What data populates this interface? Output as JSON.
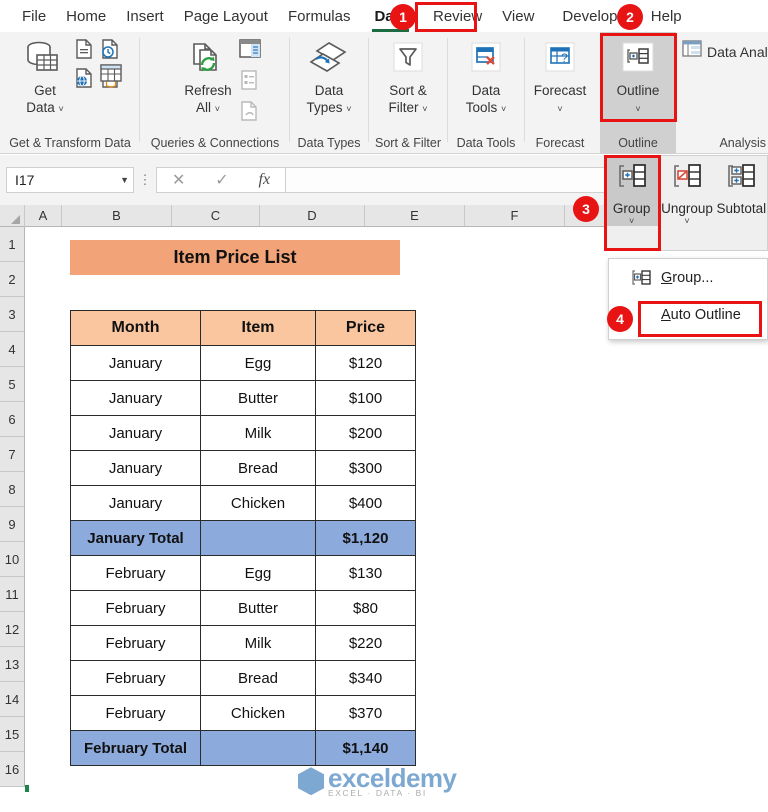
{
  "app": {
    "tabs": [
      {
        "label": "File",
        "active": false
      },
      {
        "label": "Home",
        "active": false
      },
      {
        "label": "Insert",
        "active": false
      },
      {
        "label": "Page Layout",
        "active": false
      },
      {
        "label": "Formulas",
        "active": false
      },
      {
        "label": "Data",
        "active": true
      },
      {
        "label": "Review",
        "active": false
      },
      {
        "label": "View",
        "active": false
      },
      {
        "label": "Developer",
        "active": false
      },
      {
        "label": "Help",
        "active": false
      }
    ]
  },
  "ribbon": {
    "groups": [
      {
        "name": "Get & Transform Data",
        "buttons": [
          {
            "caption_line1": "Get",
            "caption_line2": "Data",
            "has_chevron": true
          }
        ]
      },
      {
        "name": "Queries & Connections",
        "buttons": [
          {
            "caption_line1": "Refresh",
            "caption_line2": "All",
            "has_chevron": true
          }
        ]
      },
      {
        "name": "Data Types",
        "buttons": [
          {
            "caption_line1": "Data",
            "caption_line2": "Types",
            "has_chevron": true
          }
        ]
      },
      {
        "name": "Sort & Filter",
        "buttons": [
          {
            "caption_line1": "Sort &",
            "caption_line2": "Filter",
            "has_chevron": true
          }
        ]
      },
      {
        "name": "Data Tools",
        "buttons": [
          {
            "caption_line1": "Data",
            "caption_line2": "Tools",
            "has_chevron": true
          }
        ]
      },
      {
        "name": "Forecast",
        "buttons": [
          {
            "caption_line1": "Forecast",
            "caption_line2": "",
            "has_chevron": true
          }
        ]
      },
      {
        "name": "Outline",
        "buttons": [
          {
            "caption_line1": "Outline",
            "caption_line2": "",
            "has_chevron": true
          }
        ]
      },
      {
        "name": "Analysis",
        "buttons": [
          {
            "caption_line1": "Data Analysis",
            "caption_line2": "",
            "has_chevron": false
          }
        ]
      }
    ],
    "outline_flyout": {
      "buttons": [
        {
          "label": "Group",
          "selected": true,
          "has_chevron": true
        },
        {
          "label": "Ungroup",
          "selected": false,
          "has_chevron": true
        },
        {
          "label": "Subtotal",
          "selected": false,
          "has_chevron": false
        }
      ]
    },
    "group_menu": {
      "items": [
        {
          "label": "Group...",
          "underline_char": "G",
          "has_icon": true,
          "highlighted": false
        },
        {
          "label": "Auto Outline",
          "underline_char": "A",
          "has_icon": false,
          "highlighted": true
        }
      ]
    }
  },
  "formula_bar": {
    "name_box_value": "I17",
    "cancel_icon": "cancel-icon",
    "confirm_icon": "confirm-icon",
    "function_icon": "fx-icon",
    "formula_value": ""
  },
  "grid": {
    "columns": [
      "A",
      "B",
      "C",
      "D",
      "E",
      "F"
    ],
    "rows": [
      "1",
      "2",
      "3",
      "4",
      "5",
      "6",
      "7",
      "8",
      "9",
      "10",
      "11",
      "12",
      "13",
      "14",
      "15",
      "16"
    ]
  },
  "worksheet": {
    "title": "Item Price List",
    "headers": [
      "Month",
      "Item",
      "Price"
    ],
    "rows": [
      {
        "month": "January",
        "item": "Egg",
        "price": "$120",
        "total": false
      },
      {
        "month": "January",
        "item": "Butter",
        "price": "$100",
        "total": false
      },
      {
        "month": "January",
        "item": "Milk",
        "price": "$200",
        "total": false
      },
      {
        "month": "January",
        "item": "Bread",
        "price": "$300",
        "total": false
      },
      {
        "month": "January",
        "item": "Chicken",
        "price": "$400",
        "total": false
      },
      {
        "month": "January Total",
        "item": "",
        "price": "$1,120",
        "total": true
      },
      {
        "month": "February",
        "item": "Egg",
        "price": "$130",
        "total": false
      },
      {
        "month": "February",
        "item": "Butter",
        "price": "$80",
        "total": false
      },
      {
        "month": "February",
        "item": "Milk",
        "price": "$220",
        "total": false
      },
      {
        "month": "February",
        "item": "Bread",
        "price": "$340",
        "total": false
      },
      {
        "month": "February",
        "item": "Chicken",
        "price": "$370",
        "total": false
      },
      {
        "month": "February Total",
        "item": "",
        "price": "$1,140",
        "total": true
      }
    ]
  },
  "annotations": {
    "badges": [
      {
        "number": "1",
        "target": "data-tab"
      },
      {
        "number": "2",
        "target": "outline-button"
      },
      {
        "number": "3",
        "target": "group-button"
      },
      {
        "number": "4",
        "target": "auto-outline-menu-item"
      }
    ]
  },
  "watermark": {
    "brand": "exceldemy",
    "tagline": "EXCEL · DATA · BI"
  },
  "colors": {
    "title_fill": "#F2A377",
    "header_fill": "#FAC6A0",
    "total_fill": "#8CAADC",
    "accent_red": "#e81313",
    "tab_underline": "#1d6b42",
    "brand_blue": "#2e74b5"
  }
}
